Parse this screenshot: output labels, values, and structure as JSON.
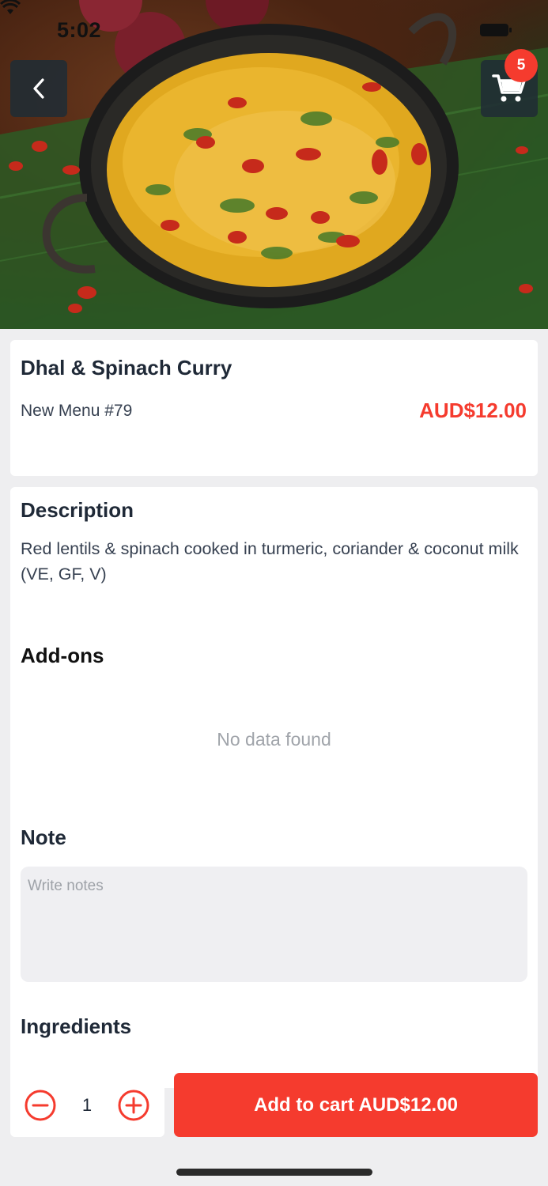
{
  "status_bar": {
    "time": "5:02"
  },
  "header": {
    "back_icon": "chevron-left-icon",
    "cart_icon": "shopping-cart-icon",
    "cart_count": "5"
  },
  "item": {
    "name": "Dhal & Spinach Curry",
    "menu_code": "New Menu #79",
    "price": "AUD$12.00"
  },
  "description": {
    "heading": "Description",
    "text": "Red lentils & spinach cooked in turmeric, coriander & coconut milk\n(VE, GF, V)"
  },
  "addons": {
    "heading": "Add-ons",
    "empty_text": "No data found"
  },
  "note": {
    "heading": "Note",
    "placeholder": "Write notes",
    "value": ""
  },
  "ingredients": {
    "heading": "Ingredients"
  },
  "quantity": {
    "value": "1"
  },
  "cta": {
    "label": "Add to cart AUD$12.00"
  },
  "colors": {
    "accent": "#f53b2e",
    "background": "#eeeef0",
    "card": "#ffffff",
    "text": "#1f2937"
  }
}
